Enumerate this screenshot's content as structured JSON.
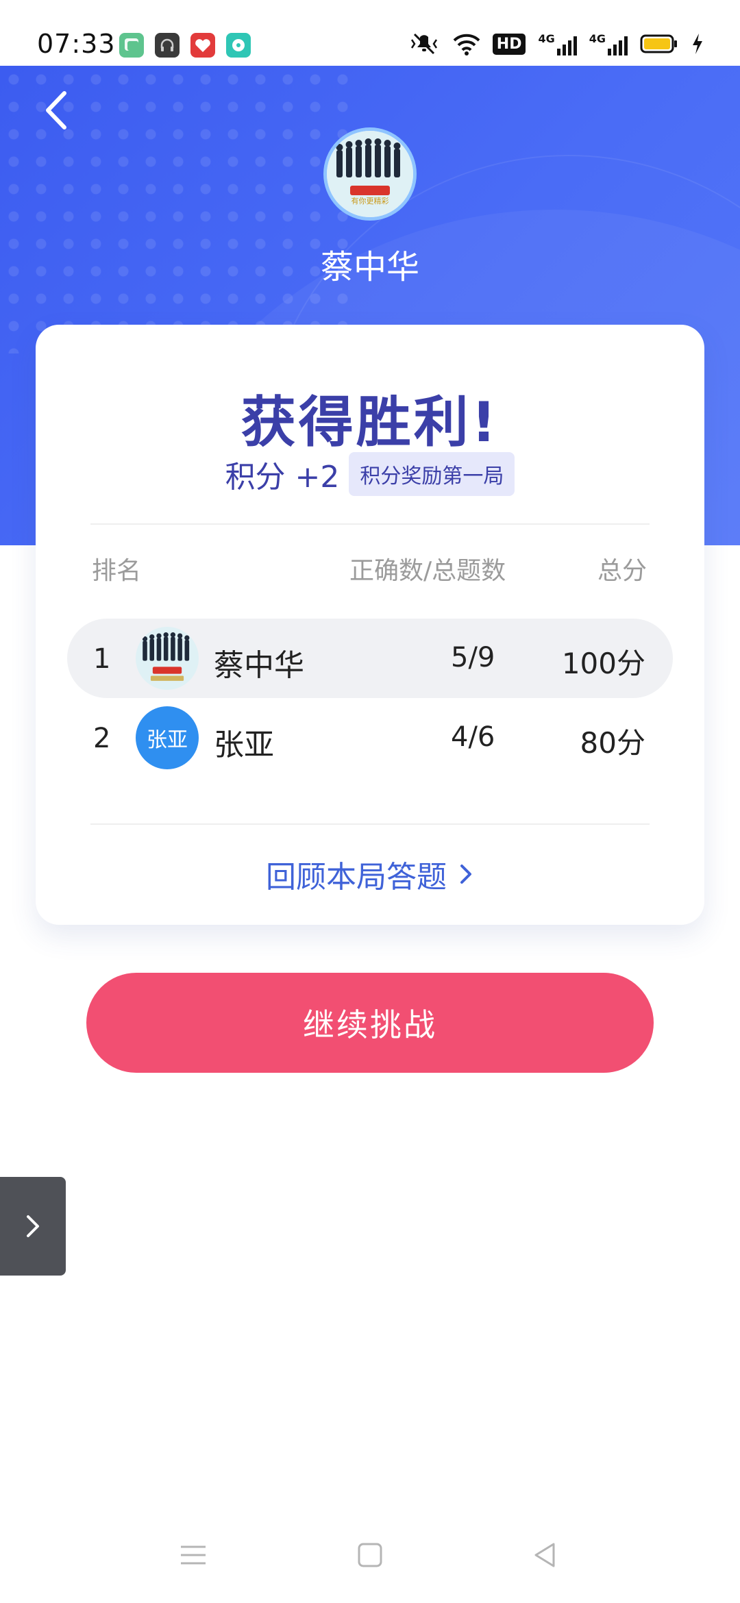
{
  "status_bar": {
    "time": "07:33",
    "app_icons": [
      "chat-app-icon",
      "headphones-app-icon",
      "heart-app-icon",
      "music-app-icon"
    ],
    "indicators": [
      "mute-vibrate-icon",
      "wifi-icon",
      "hd-icon",
      "signal-4g-icon",
      "signal-4g-icon",
      "battery-icon",
      "charging-icon"
    ],
    "network_1": "4G",
    "network_2": "4G",
    "hd_label": "HD"
  },
  "header": {
    "user_name": "蔡中华",
    "avatar_caption": "有你更精彩"
  },
  "result": {
    "title": "获得胜利!",
    "points": "积分 +2",
    "points_badge": "积分奖励第一局"
  },
  "table": {
    "headers": {
      "rank": "排名",
      "correct": "正确数/总题数",
      "score": "总分"
    },
    "rows": [
      {
        "rank": "1",
        "name": "蔡中华",
        "avatar_text": "",
        "correct": "5/9",
        "score": "100分",
        "highlight": true
      },
      {
        "rank": "2",
        "name": "张亚",
        "avatar_text": "张亚",
        "correct": "4/6",
        "score": "80分",
        "highlight": false
      }
    ]
  },
  "review_link": "回顾本局答题",
  "continue_button": "继续挑战",
  "colors": {
    "primary_blue": "#4a6cf6",
    "title_indigo": "#3b3fa8",
    "link_blue": "#3f62d8",
    "button_pink": "#f24f72",
    "avatar_blue": "#2f8ff0"
  }
}
